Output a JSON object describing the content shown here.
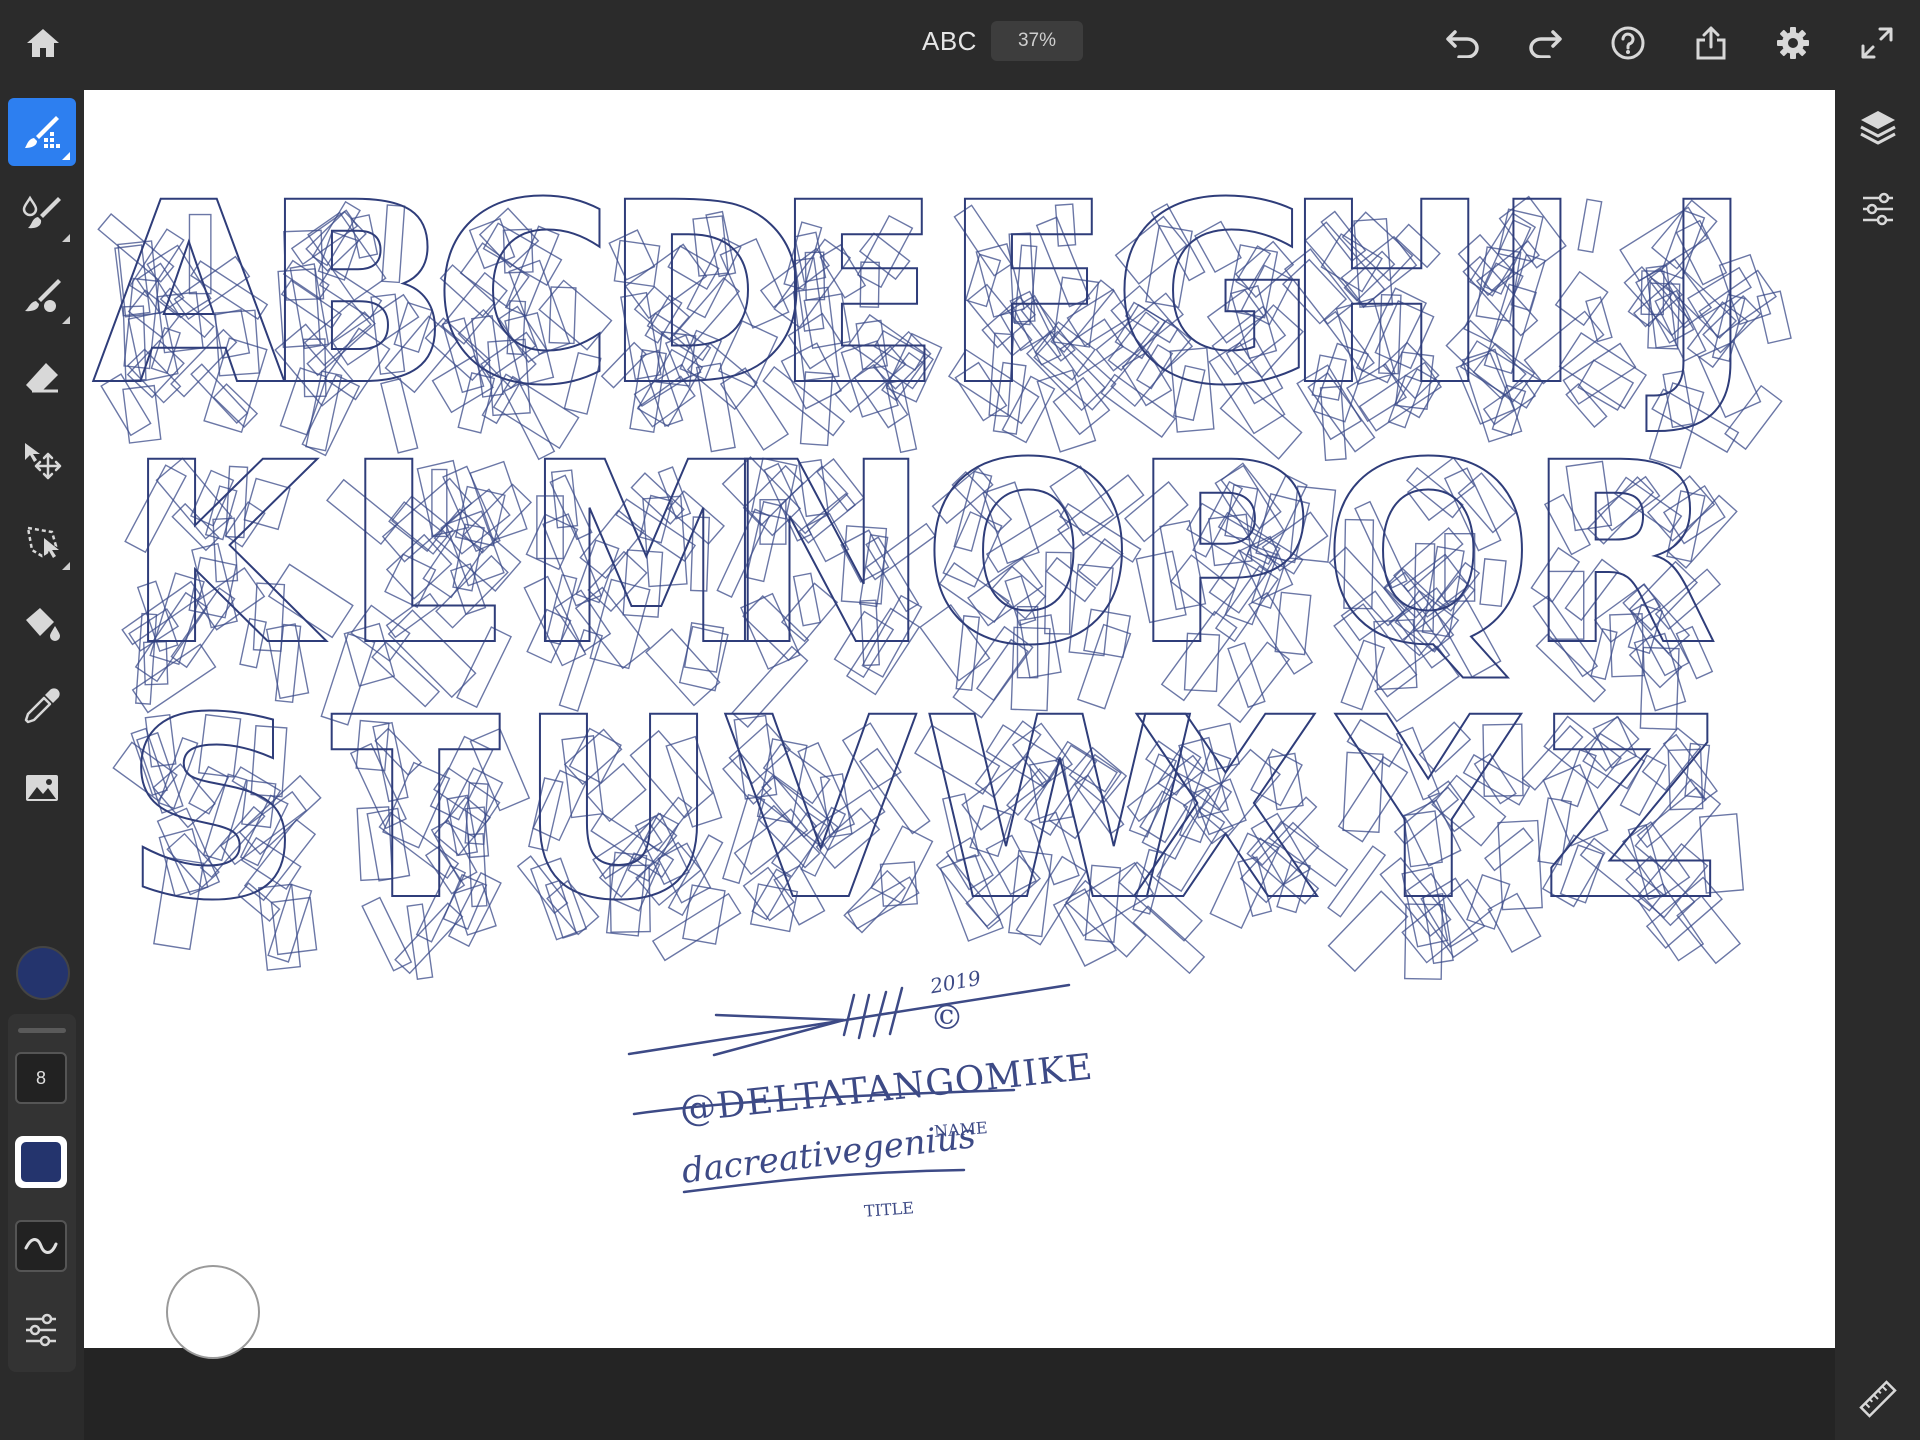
{
  "topbar": {
    "title": "ABC",
    "zoom": "37%",
    "icons": [
      "home-icon",
      "undo-icon",
      "redo-icon",
      "help-icon",
      "share-icon",
      "settings-icon",
      "fullscreen-icon"
    ]
  },
  "tools": [
    "brush-grid-icon",
    "watercolor-brush-icon",
    "pixel-brush-icon",
    "eraser-icon",
    "transform-icon",
    "lasso-icon",
    "fill-icon",
    "eyedropper-icon",
    "image-icon"
  ],
  "brush_panel": {
    "size": "8"
  },
  "colors": {
    "brush": "#24346d",
    "accent": "#2d7ff0",
    "ink": "#2f3d7a"
  },
  "canvas": {
    "letter_rows": [
      [
        "A",
        "B",
        "C",
        "D",
        "E",
        "F",
        "G",
        "H",
        "I",
        "J"
      ],
      [
        "K",
        "L",
        "M",
        "N",
        "O",
        "P",
        "Q",
        "R"
      ],
      [
        "S",
        "T",
        "U",
        "V",
        "W",
        "X",
        "Y",
        "Z"
      ]
    ],
    "signature": {
      "year": "2019",
      "copyright": "©",
      "handle": "@DELTATANGOMIKE",
      "name_label": "NAME",
      "title_value": "dacreativegenius",
      "title_label": "TITLE"
    }
  },
  "right_icons": [
    "layers-icon",
    "adjustments-icon",
    "ruler-icon"
  ]
}
